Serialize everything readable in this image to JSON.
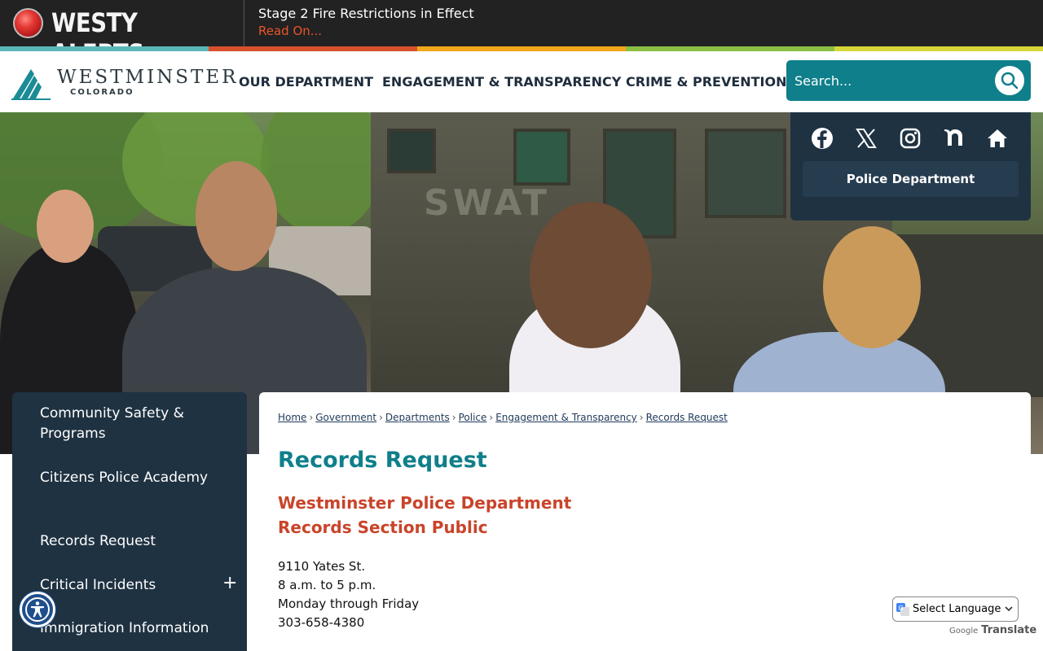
{
  "alert": {
    "brand": "WESTY ALERTS",
    "message": "Stage 2 Fire Restrictions in Effect",
    "link_label": "Read On..."
  },
  "colors": {
    "stripe": [
      "#5bb8b8",
      "#d9502c",
      "#f2a71b",
      "#8bbf44",
      "#d6d63a"
    ],
    "accent_teal": "#0f7f8b",
    "heading_red": "#c9442a",
    "navy": "#1f3242"
  },
  "logo": {
    "name": "WESTMINSTER",
    "subtitle": "COLORADO"
  },
  "nav": {
    "items": [
      "OUR DEPARTMENT",
      "ENGAGEMENT & TRANSPARENCY",
      "CRIME & PREVENTION"
    ]
  },
  "search": {
    "placeholder": "Search...",
    "icon": "search-icon"
  },
  "social": {
    "icons": [
      "facebook-icon",
      "x-icon",
      "instagram-icon",
      "nextdoor-icon",
      "home-icon"
    ],
    "dept_label": "Police Department"
  },
  "hero": {
    "truck_text": "SWAT"
  },
  "sidenav": {
    "items": [
      {
        "label": "Community Safety & Programs"
      },
      {
        "label": "Citizens Police Academy"
      },
      {
        "label": "Records Request"
      },
      {
        "label": "Critical Incidents",
        "expandable": true
      },
      {
        "label": "Immigration Information"
      }
    ],
    "expand_glyph": "+"
  },
  "breadcrumb": [
    "Home",
    "Government",
    "Departments",
    "Police",
    "Engagement & Transparency",
    "Records Request"
  ],
  "breadcrumb_sep": "›",
  "content": {
    "title": "Records Request",
    "subheading_1": "Westminster Police Department",
    "subheading_2": "Records Section Public",
    "address": "9110 Yates St.",
    "hours": "8 a.m. to 5 p.m.",
    "days": "Monday through Friday",
    "phone": "303-658-4380"
  },
  "translate": {
    "select_label": "Select Language",
    "powered_by": "Google",
    "translate_word": "Translate"
  }
}
